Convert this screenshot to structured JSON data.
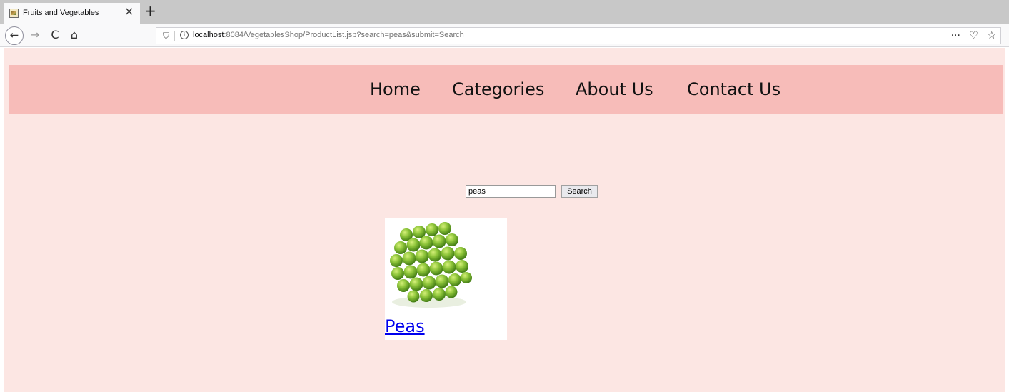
{
  "browser": {
    "tab_title": "Fruits and Vegetables",
    "tab_close": "×",
    "new_tab": "+",
    "url_host": "localhost",
    "url_rest": ":8084/VegetablesShop/ProductList.jsp?search=peas&submit=Search",
    "icons": {
      "back": "←",
      "forward": "→",
      "reload": "C",
      "home": "⌂",
      "shield": "⛉",
      "info": "i",
      "more": "···",
      "pocket": "♡",
      "bookmark": "☆"
    }
  },
  "page": {
    "background": "#fce6e3",
    "menu_background": "#f7bcb9",
    "menu": [
      "Home",
      "Categories",
      "About Us",
      "Contact Us"
    ],
    "search": {
      "value": "peas",
      "button_label": "Search"
    },
    "product": {
      "name": "Peas",
      "image": "green-peas-photo"
    }
  }
}
